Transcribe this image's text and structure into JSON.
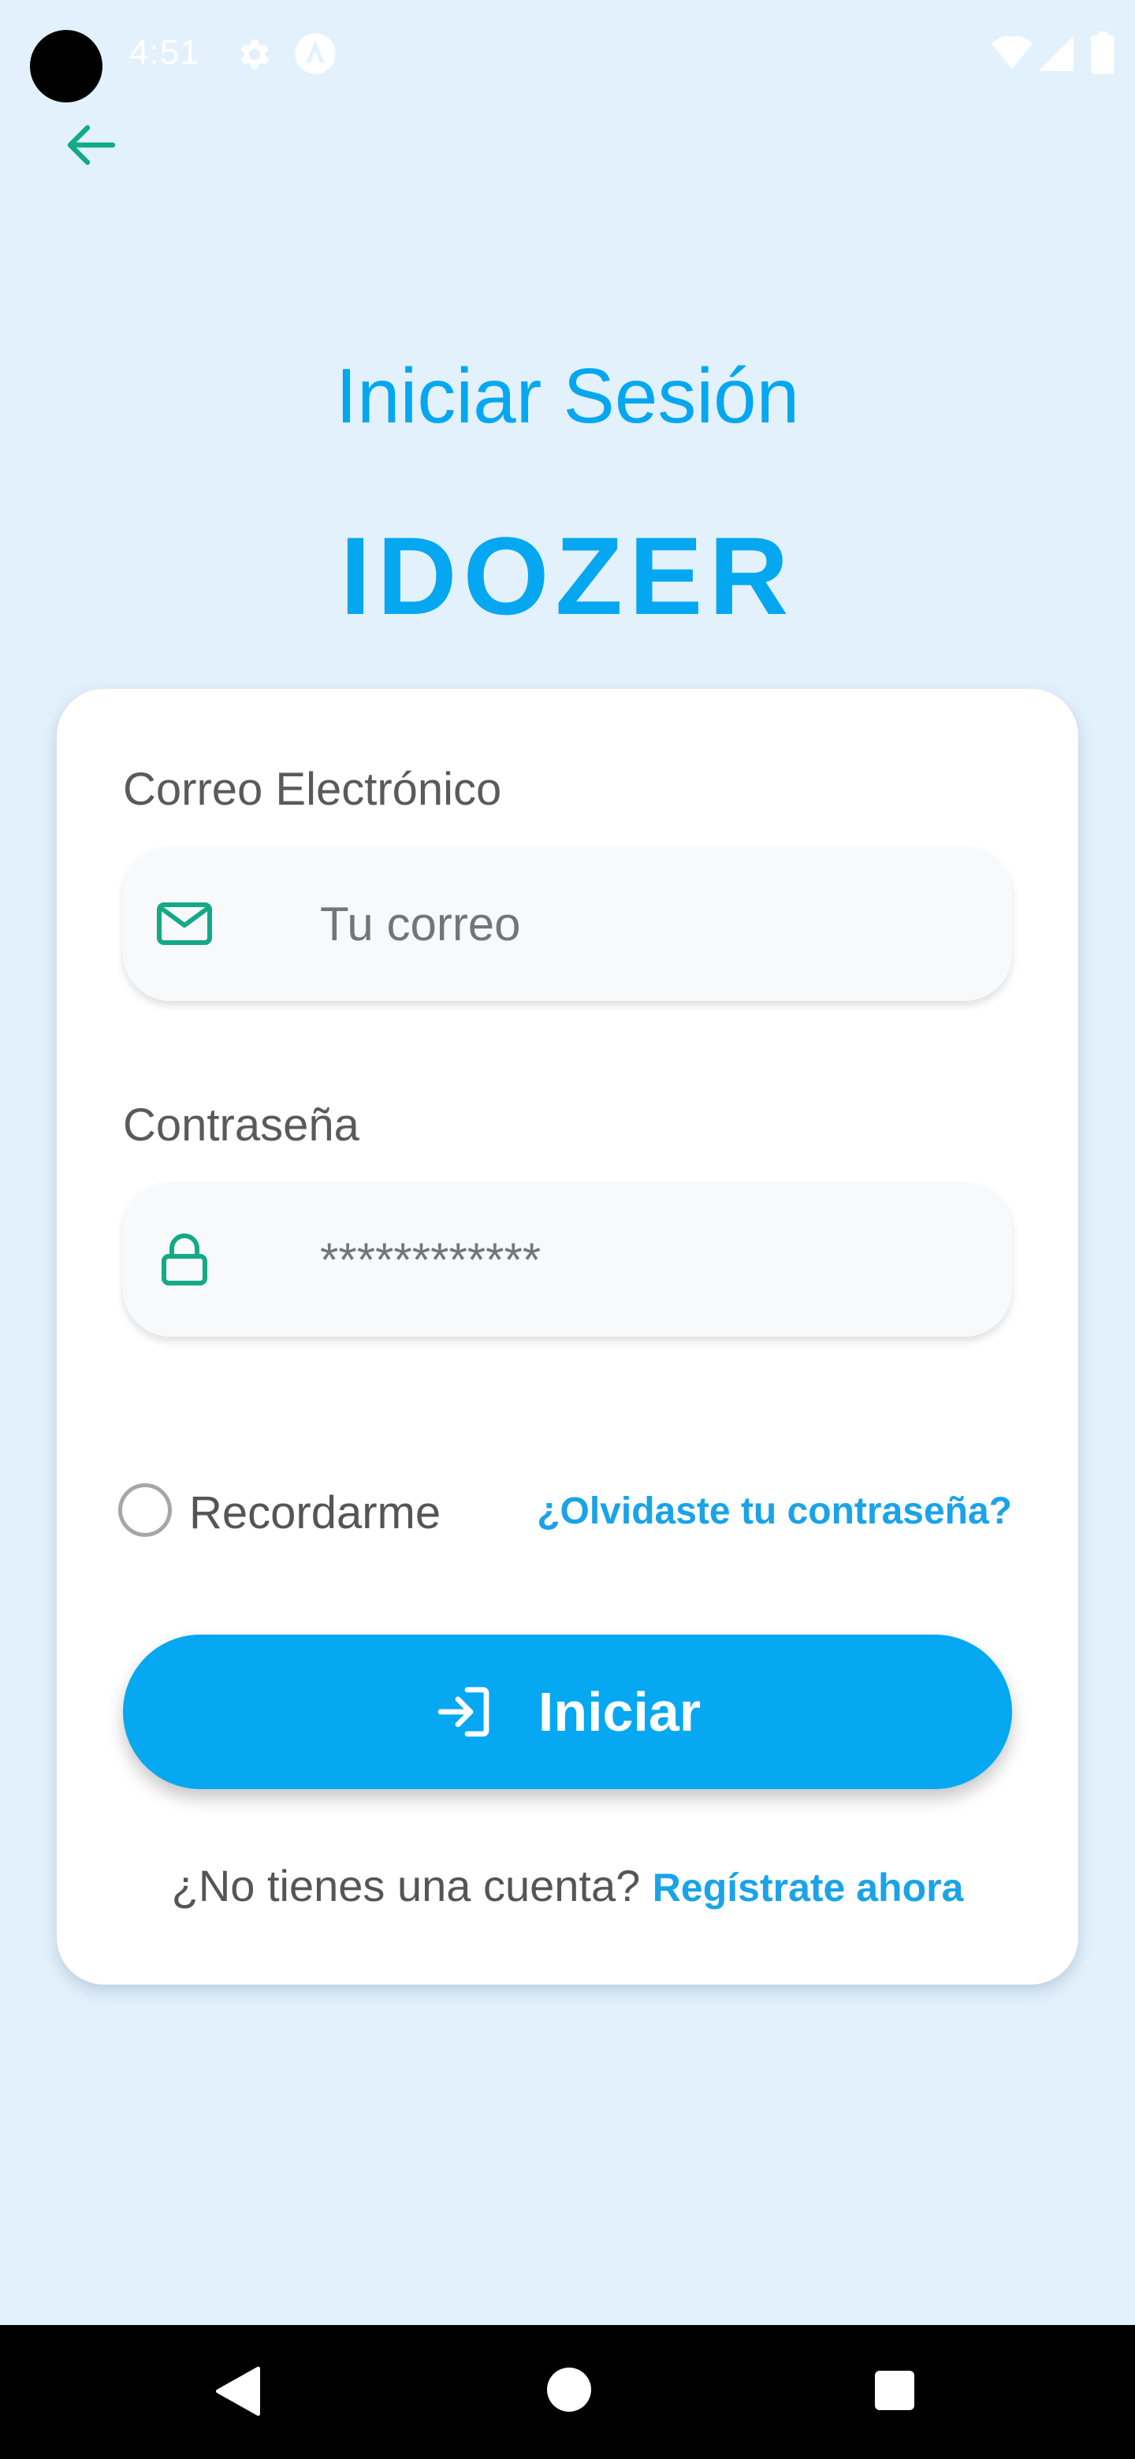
{
  "status_bar": {
    "time": "4:51",
    "icons": [
      "camera-dot",
      "gear-icon",
      "app-icon",
      "wifi-icon",
      "signal-icon",
      "battery-icon"
    ]
  },
  "header": {
    "back_icon": "arrow-left-icon",
    "title": "Iniciar Sesión",
    "brand": "IDOZER"
  },
  "form": {
    "email": {
      "label": "Correo Electrónico",
      "placeholder": "Tu correo",
      "icon": "mail-icon"
    },
    "password": {
      "label": "Contraseña",
      "placeholder": "************",
      "icon": "lock-icon"
    },
    "remember": {
      "label": "Recordarme",
      "checked": false
    },
    "forgot_link": "¿Olvidaste tu contraseña?",
    "submit": {
      "label": "Iniciar",
      "icon": "login-icon"
    },
    "signup": {
      "prompt": "¿No tienes una cuenta?",
      "link": "Regístrate ahora"
    }
  },
  "colors": {
    "background": "#e3f1fc",
    "primary": "#05a8f1",
    "icon_accent": "#14a987",
    "card": "#ffffff"
  },
  "nav_bar": {
    "buttons": [
      "nav-back-icon",
      "nav-home-icon",
      "nav-recents-icon"
    ]
  }
}
